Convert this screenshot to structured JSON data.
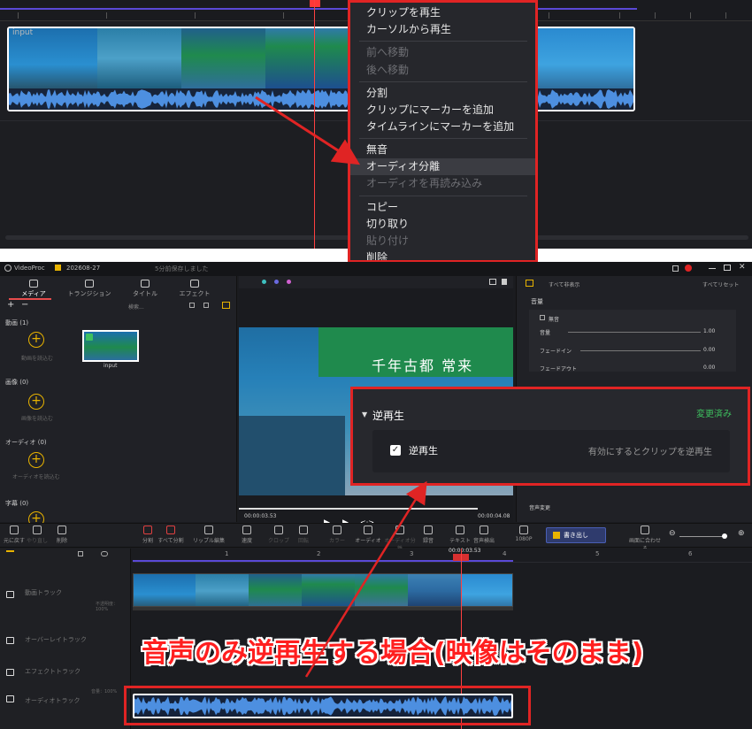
{
  "top": {
    "clip_label": "input",
    "menu_items": [
      {
        "label": "クリップを再生",
        "disabled": false
      },
      {
        "label": "カーソルから再生",
        "disabled": false
      },
      {
        "label": "前へ移動",
        "disabled": true
      },
      {
        "label": "後へ移動",
        "disabled": true
      },
      {
        "label": "分割",
        "disabled": false
      },
      {
        "label": "クリップにマーカーを追加",
        "disabled": false
      },
      {
        "label": "タイムラインにマーカーを追加",
        "disabled": false
      },
      {
        "label": "無音",
        "disabled": false
      },
      {
        "label": "オーディオ分離",
        "disabled": false
      },
      {
        "label": "オーディオを再読み込み",
        "disabled": true
      },
      {
        "label": "コピー",
        "disabled": false
      },
      {
        "label": "切り取り",
        "disabled": false
      },
      {
        "label": "貼り付け",
        "disabled": true
      },
      {
        "label": "削除",
        "disabled": false
      }
    ]
  },
  "app": {
    "name": "VideoProc",
    "project": "202608-27",
    "save_status": "5分前保存しました",
    "tabs": [
      "メディア",
      "トランジション",
      "タイトル",
      "エフェクト"
    ],
    "search_placeholder": "検索...",
    "sections": {
      "video": "動画 (1)",
      "image": "画像 (0)",
      "audio": "オーディオ (0)",
      "subtitle": "字幕 (0)"
    },
    "hints": {
      "video": "動画を読込む",
      "image": "画像を読込む",
      "audio": "オーディオを読込む"
    },
    "media_item": "input",
    "preview": {
      "banner_text": "千年古都 常来",
      "current_time": "00:00:03.53",
      "total_time": "00:00:04.08"
    },
    "right": {
      "show_all": "すべて非表示",
      "reset_all": "すべてリセット",
      "volume_section": "音量",
      "mute": "無音",
      "volume": "音量",
      "volume_value": "1.00",
      "fade_in": "フェードイン",
      "fade_in_value": "0.00",
      "fade_out": "フェードアウト",
      "fade_out_value": "0.00",
      "reverse_title": "逆再生",
      "reverse_status": "変更済み",
      "reverse_checkbox": "逆再生",
      "reverse_desc": "有効にするとクリップを逆再生",
      "pitch": "音声変更"
    },
    "toolbar": {
      "undo": "元に戻す",
      "redo": "やり直し",
      "delete": "削除",
      "split": "分割",
      "split_all": "すべて分割",
      "ripple": "リップル編集",
      "speed": "速度",
      "crop": "クロップ",
      "rotate": "回転",
      "color": "カラー",
      "audio": "オーディオ",
      "audio_split": "オーディオ分離",
      "record": "録音",
      "text": "テキスト",
      "voice_detect": "音声検出",
      "resolution": "1080P",
      "export": "書き出し",
      "fit": "画面に合わせる"
    },
    "timeline": {
      "playhead_time": "00:00:03.53",
      "ruler": [
        "1",
        "2",
        "3",
        "4",
        "5",
        "6"
      ],
      "tracks": [
        "動画トラック",
        "オーバーレイトラック",
        "エフェクトトラック",
        "オーディオトラック"
      ],
      "speed_tag": "不透明度：100%",
      "volume_tag": "音量：100%"
    }
  },
  "caption": "音声のみ逆再生する場合(映像はそのまま)",
  "colors": {
    "highlight_red": "#e02424",
    "accent_purple": "#5a49d6",
    "accent_yellow": "#e8b300",
    "status_green": "#3ec05f"
  }
}
